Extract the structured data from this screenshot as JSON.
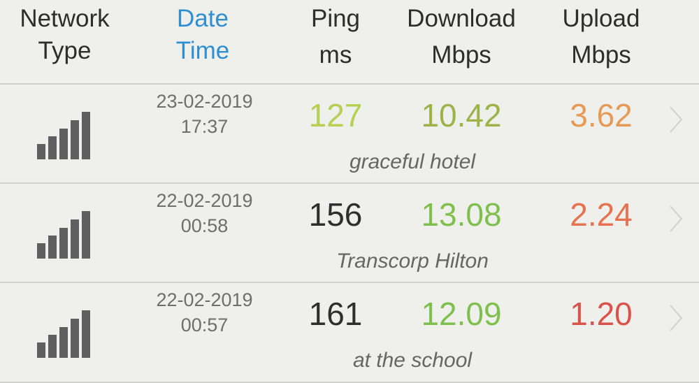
{
  "header": {
    "network_type": [
      "Network",
      "Type"
    ],
    "date_time": [
      "Date",
      "Time"
    ],
    "ping": [
      "Ping",
      "ms"
    ],
    "download": [
      "Download",
      "Mbps"
    ],
    "upload": [
      "Upload",
      "Mbps"
    ]
  },
  "colors": {
    "header_accent": "#2f8fd0",
    "signal_bars": "#5f5e60",
    "chevron": "#d0d0d0"
  },
  "results": [
    {
      "network_icon": "signal-bars-icon",
      "signal_level": "5/5",
      "date": "23-02-2019",
      "time": "17:37",
      "ping": "127",
      "ping_color": "#b7cf52",
      "download": "10.42",
      "download_color": "#9eb24a",
      "upload": "3.62",
      "upload_color": "#e59a55",
      "location": "graceful hotel"
    },
    {
      "network_icon": "signal-bars-icon",
      "signal_level": "5/5",
      "date": "22-02-2019",
      "time": "00:58",
      "ping": "156",
      "ping_color": "#2e2e2e",
      "download": "13.08",
      "download_color": "#7fbf4e",
      "upload": "2.24",
      "upload_color": "#e77250",
      "location": "Transcorp Hilton"
    },
    {
      "network_icon": "signal-bars-icon",
      "signal_level": "5/5",
      "date": "22-02-2019",
      "time": "00:57",
      "ping": "161",
      "ping_color": "#2e2e2e",
      "download": "12.09",
      "download_color": "#7fbf4e",
      "upload": "1.20",
      "upload_color": "#d9534a",
      "location": "at the school"
    }
  ]
}
